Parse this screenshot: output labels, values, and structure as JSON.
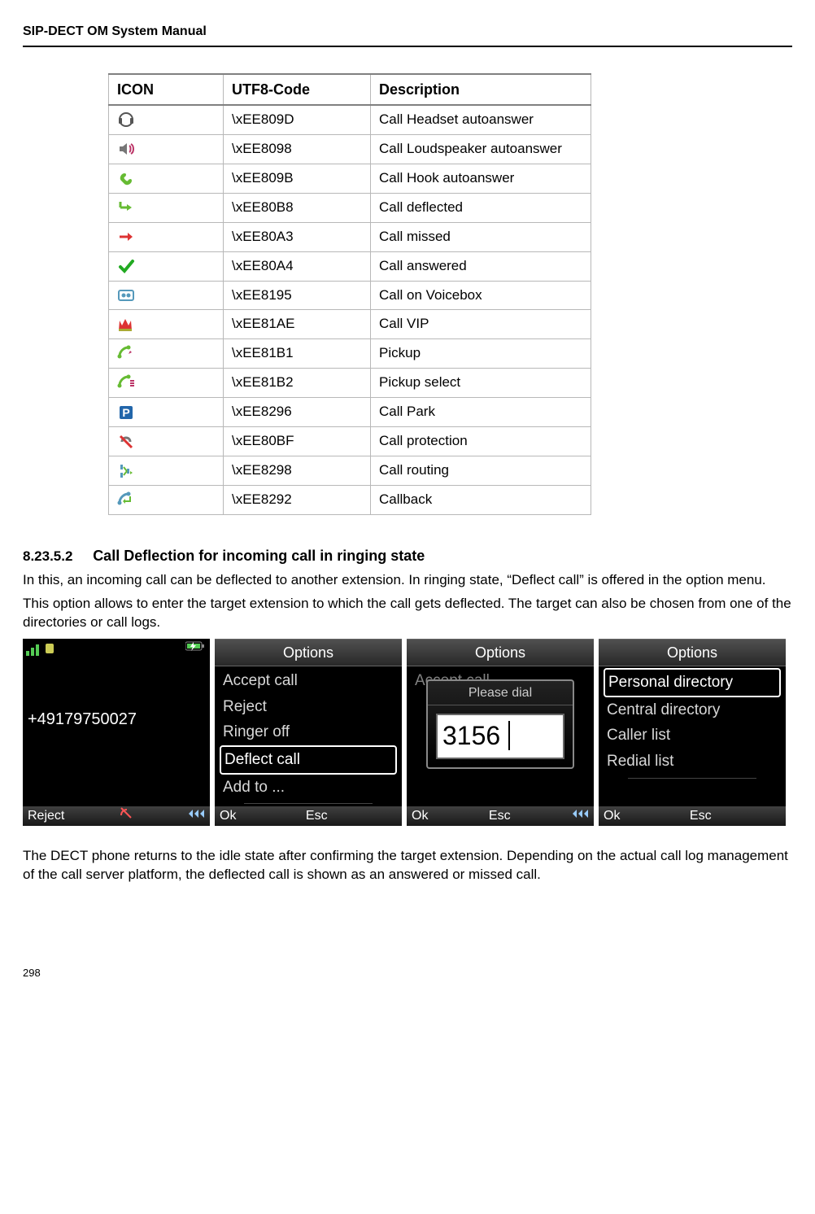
{
  "header": "SIP-DECT OM System Manual",
  "table": {
    "cols": [
      "ICON",
      "UTF8-Code",
      "Description"
    ],
    "rows": [
      {
        "icon": "headset",
        "code": "\\xEE809D",
        "desc": "Call Headset autoanswer"
      },
      {
        "icon": "speaker",
        "code": "\\xEE8098",
        "desc": "Call Loudspeaker autoanswer"
      },
      {
        "icon": "hook",
        "code": "\\xEE809B",
        "desc": "Call Hook autoanswer"
      },
      {
        "icon": "deflect",
        "code": "\\xEE80B8",
        "desc": "Call deflected"
      },
      {
        "icon": "missed",
        "code": "\\xEE80A3",
        "desc": "Call missed"
      },
      {
        "icon": "answered",
        "code": "\\xEE80A4",
        "desc": "Call answered"
      },
      {
        "icon": "voicebox",
        "code": "\\xEE8195",
        "desc": "Call on Voicebox"
      },
      {
        "icon": "vip",
        "code": "\\xEE81AE",
        "desc": "Call VIP"
      },
      {
        "icon": "pickup",
        "code": "\\xEE81B1",
        "desc": "Pickup"
      },
      {
        "icon": "pickupsel",
        "code": "\\xEE81B2",
        "desc": "Pickup select"
      },
      {
        "icon": "park",
        "code": "\\xEE8296",
        "desc": "Call Park"
      },
      {
        "icon": "protect",
        "code": "\\xEE80BF",
        "desc": "Call protection"
      },
      {
        "icon": "routing",
        "code": "\\xEE8298",
        "desc": "Call routing"
      },
      {
        "icon": "callback",
        "code": "\\xEE8292",
        "desc": "Callback"
      }
    ]
  },
  "section_num": "8.23.5.2",
  "section_title": "Call Deflection for incoming call in ringing state",
  "para1": "In this, an incoming call can be deflected to another extension. In ringing state, “Deflect call” is offered in the option menu.",
  "para2": "This option allows to enter the target extension to which the call gets deflected. The target can also be chosen from one of the directories or call logs.",
  "para3": "The DECT phone returns to the idle state after confirming the target extension. Depending on the actual call log management of the call server platform, the deflected call is shown as an answered or missed call.",
  "phone1": {
    "number": "+49179750027",
    "sk_left": "Reject"
  },
  "phone2": {
    "title": "Options",
    "items": [
      "Accept call",
      "Reject",
      "Ringer off",
      "Deflect call",
      "Add to ..."
    ],
    "selected": 3,
    "sk_left": "Ok",
    "sk_mid": "Esc"
  },
  "phone3": {
    "title": "Options",
    "faded": "Accept call",
    "popup_title": "Please dial",
    "popup_value": "3156",
    "sk_left": "Ok",
    "sk_mid": "Esc"
  },
  "phone4": {
    "title": "Options",
    "items": [
      "Personal directory",
      "Central directory",
      "Caller list",
      "Redial list"
    ],
    "selected": 0,
    "sk_left": "Ok",
    "sk_mid": "Esc"
  },
  "page_number": "298"
}
